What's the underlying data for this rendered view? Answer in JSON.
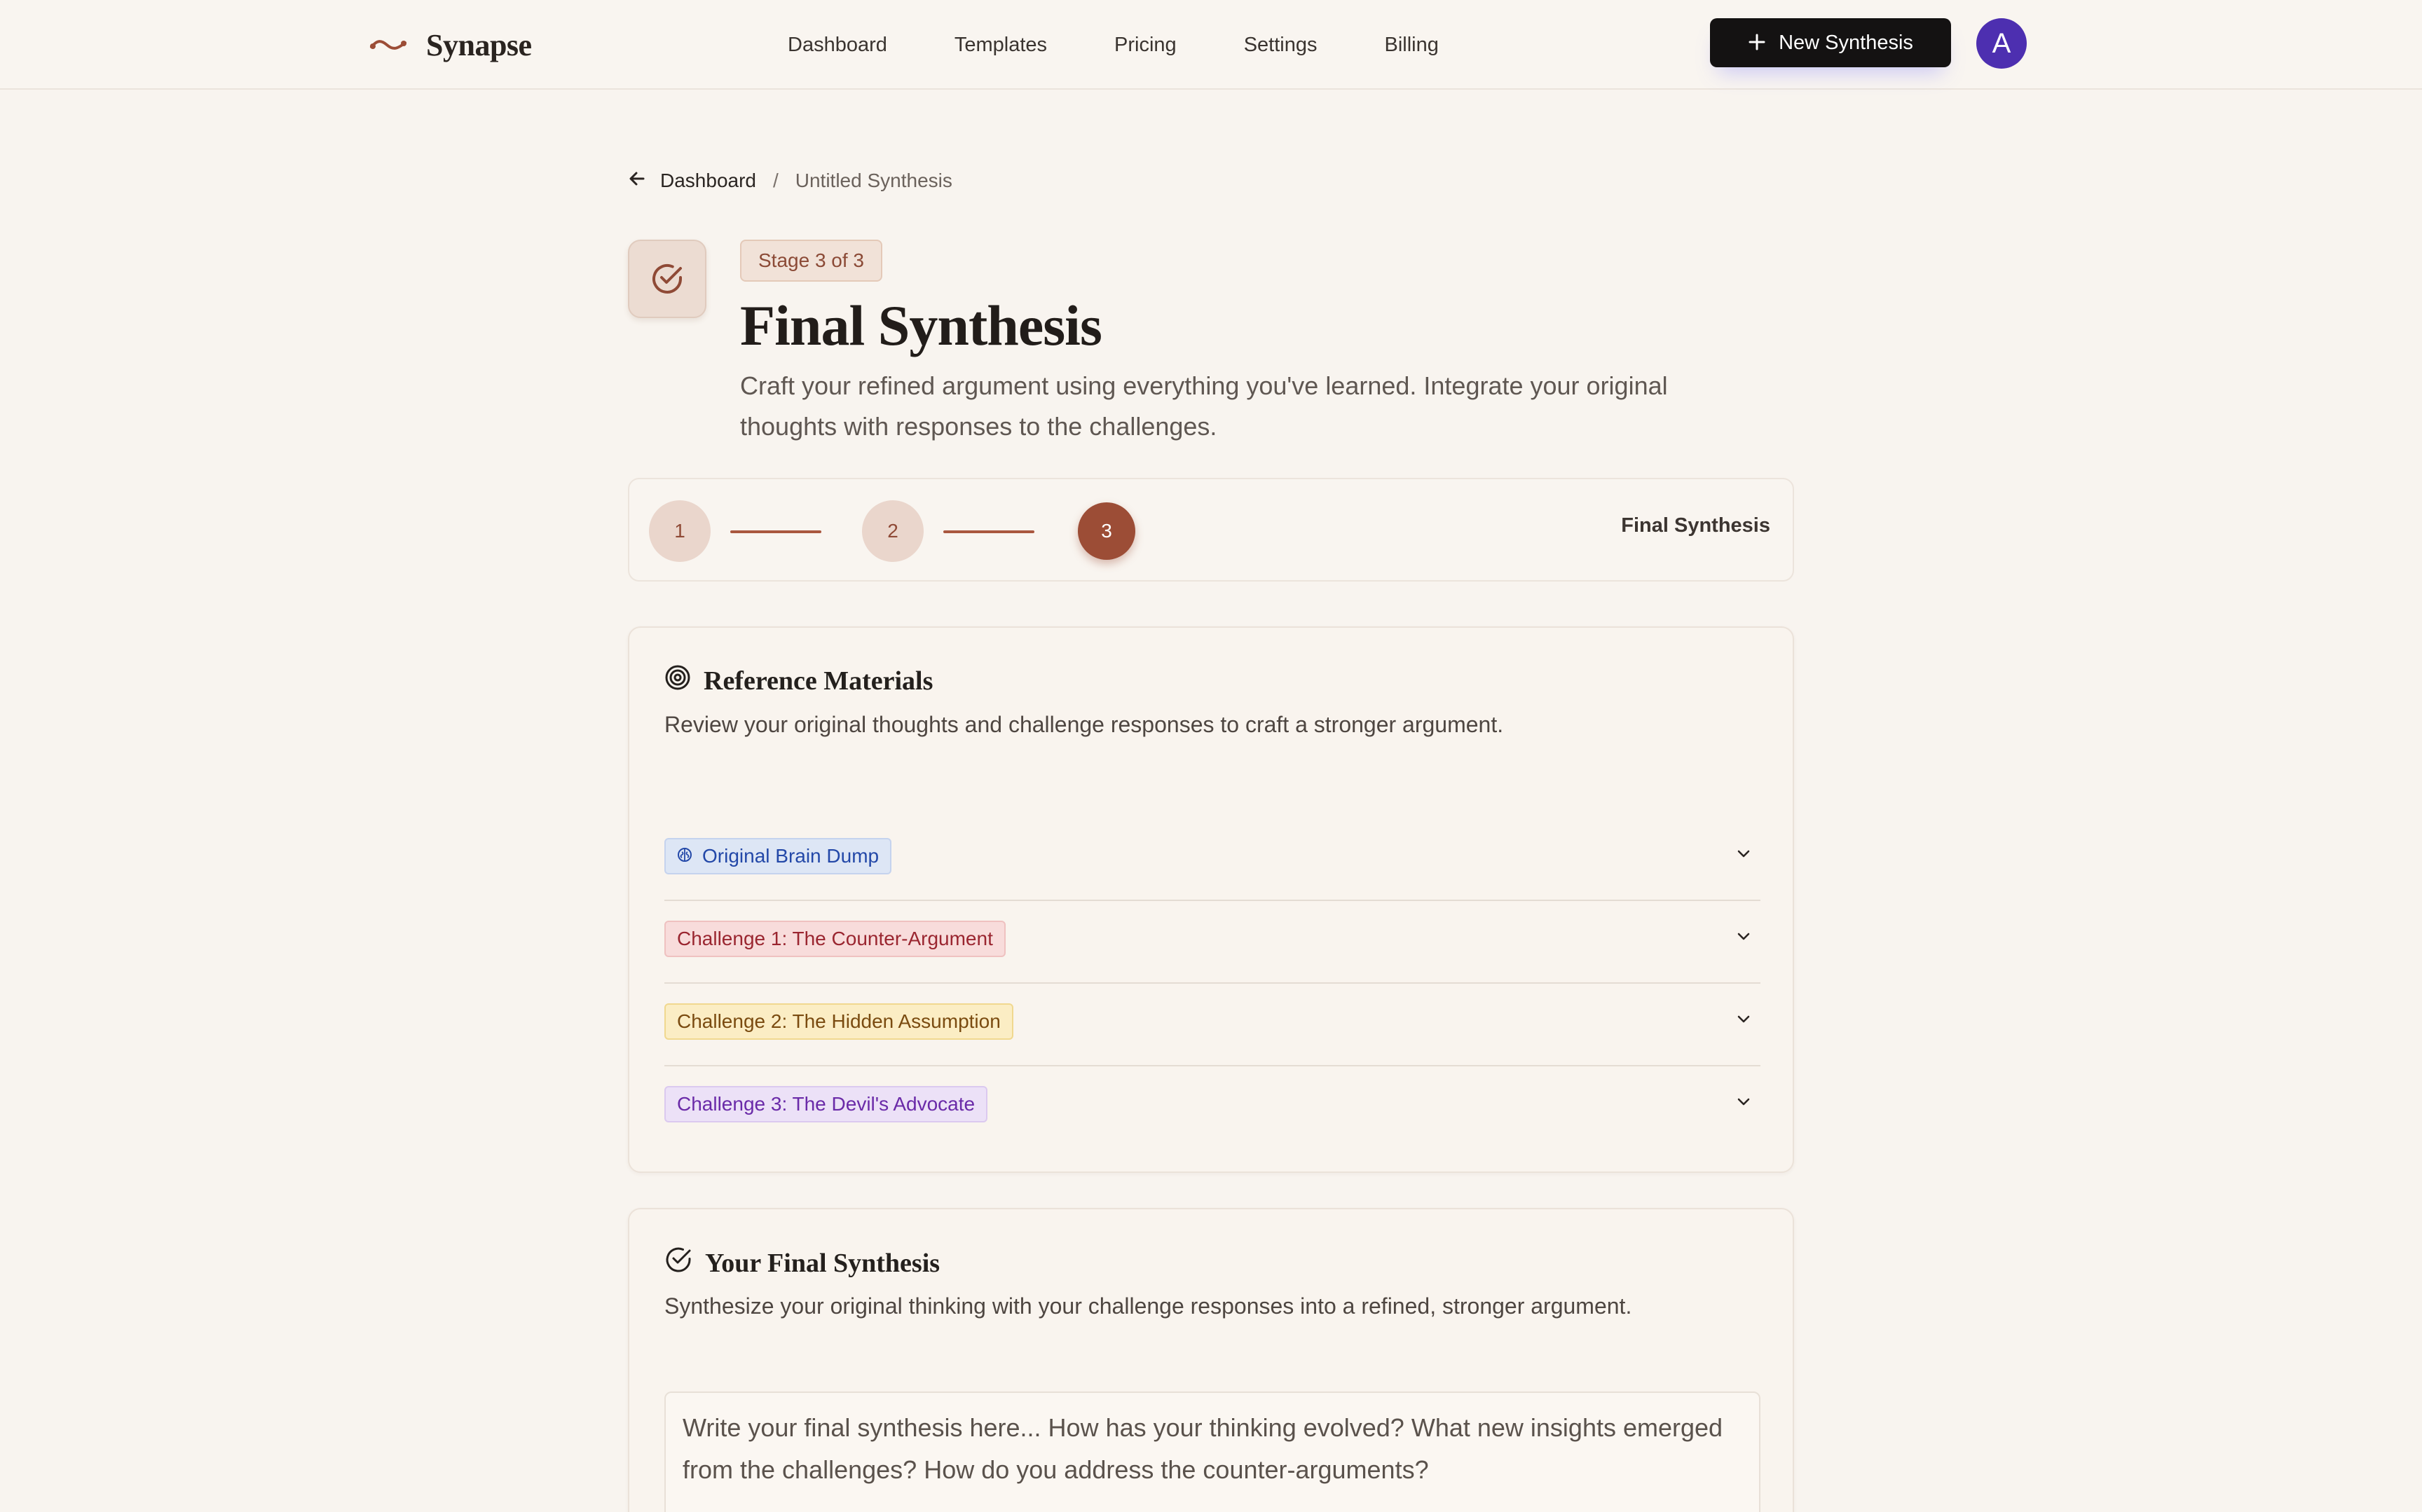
{
  "app": {
    "brand": "Synapse",
    "colors": {
      "accent": "#9c4d36",
      "background": "#f8f4ef",
      "primary_button": "#141212",
      "avatar": "#4d2fb0"
    }
  },
  "nav": {
    "items": [
      {
        "label": "Dashboard"
      },
      {
        "label": "Templates"
      },
      {
        "label": "Pricing"
      },
      {
        "label": "Settings"
      },
      {
        "label": "Billing"
      }
    ],
    "new_button": "New Synthesis",
    "avatar_initial": "A"
  },
  "breadcrumb": {
    "back_label": "Dashboard",
    "separator": "/",
    "current": "Untitled Synthesis"
  },
  "page": {
    "stage_badge": "Stage 3 of 3",
    "title": "Final Synthesis",
    "subtitle": "Craft your refined argument using everything you've learned. Integrate your original thoughts with responses to the challenges."
  },
  "stepper": {
    "steps": [
      {
        "number": "1",
        "state": "done"
      },
      {
        "number": "2",
        "state": "done"
      },
      {
        "number": "3",
        "state": "active"
      }
    ],
    "current_label": "Final Synthesis"
  },
  "reference": {
    "title": "Reference Materials",
    "description": "Review your original thoughts and challenge responses to craft a stronger argument.",
    "items": [
      {
        "label": "Original Brain Dump",
        "color": "blue",
        "icon": "brain-icon"
      },
      {
        "label": "Challenge 1: The Counter-Argument",
        "color": "red"
      },
      {
        "label": "Challenge 2: The Hidden Assumption",
        "color": "yellow"
      },
      {
        "label": "Challenge 3: The Devil's Advocate",
        "color": "purple"
      }
    ]
  },
  "synthesis": {
    "title": "Your Final Synthesis",
    "description": "Synthesize your original thinking with your challenge responses into a refined, stronger argument.",
    "placeholder": "Write your final synthesis here... How has your thinking evolved? What new insights emerged from the challenges? How do you address the counter-arguments?",
    "value": ""
  }
}
